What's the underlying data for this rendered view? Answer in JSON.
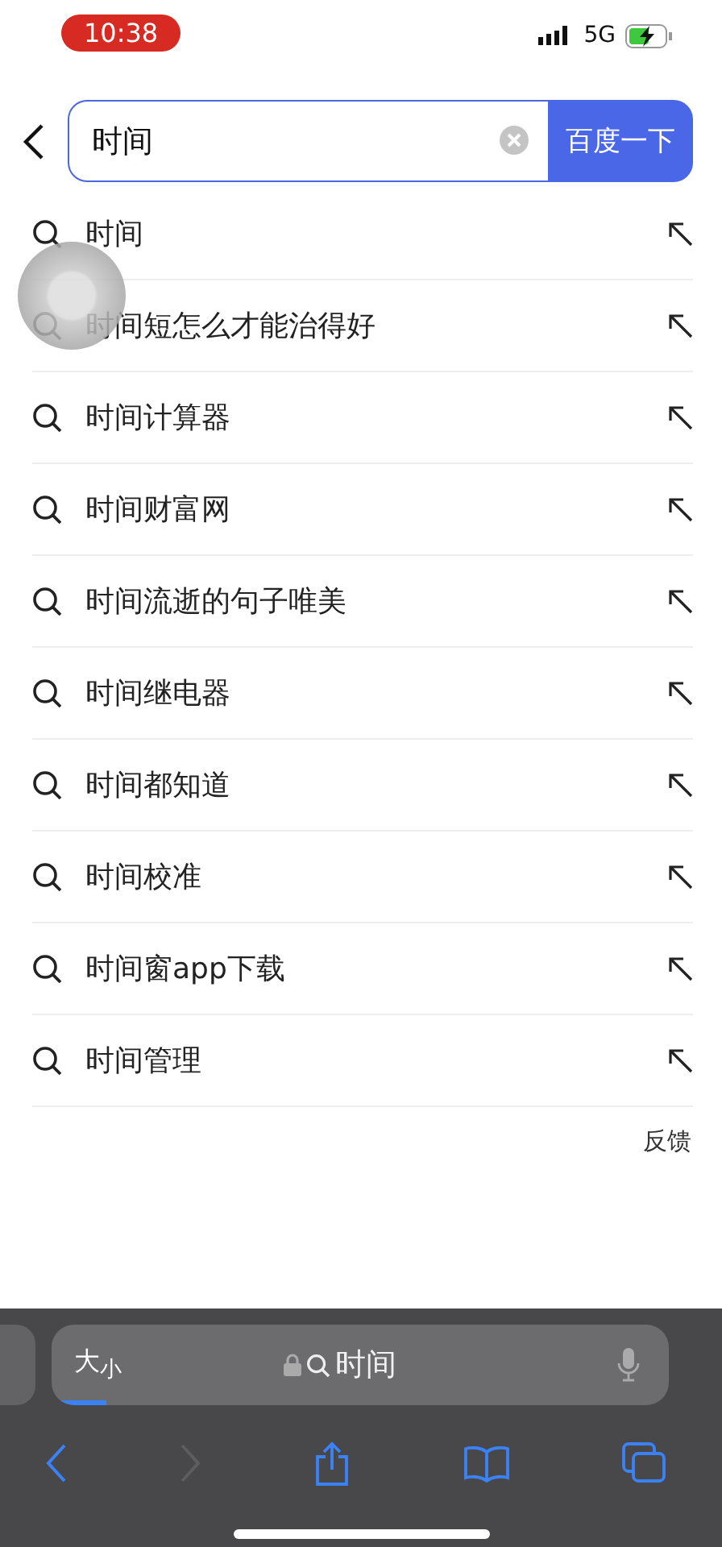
{
  "status_bar": {
    "time": "10:38",
    "network": "5G"
  },
  "search": {
    "value": "时间",
    "button": "百度一下"
  },
  "suggestions": [
    {
      "text": "时间"
    },
    {
      "text": "时间短怎么才能治得好"
    },
    {
      "text": "时间计算器"
    },
    {
      "text": "时间财富网"
    },
    {
      "text": "时间流逝的句子唯美"
    },
    {
      "text": "时间继电器"
    },
    {
      "text": "时间都知道"
    },
    {
      "text": "时间校准"
    },
    {
      "text": "时间窗app下载"
    },
    {
      "text": "时间管理"
    }
  ],
  "feedback": "反馈",
  "browser_bar": {
    "size_label": "大$_{小}$",
    "address": "时间",
    "level": 0.09
  }
}
